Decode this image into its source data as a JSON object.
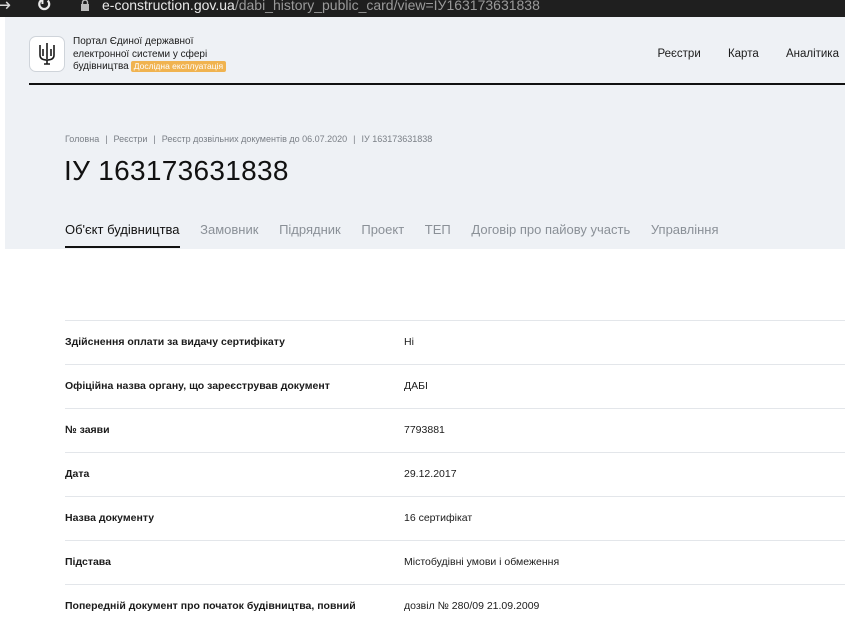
{
  "browser": {
    "domain": "e-construction.gov.ua",
    "path": "/dabi_history_public_card/view=ІУ163173631838"
  },
  "header": {
    "portal_line1": "Портал Єдиної державної",
    "portal_line2": "електронної системи у сфері",
    "portal_line3": "будівництва",
    "badge": "Дослідна експлуатація",
    "nav": [
      "Реєстри",
      "Карта",
      "Аналітика"
    ]
  },
  "breadcrumbs": [
    "Головна",
    "Реєстри",
    "Реєстр дозвільних документів до 06.07.2020",
    "ІУ 163173631838"
  ],
  "page_title": "ІУ 163173631838",
  "tabs": [
    "Об'єкт будівництва",
    "Замовник",
    "Підрядник",
    "Проект",
    "ТЕП",
    "Договір про пайову участь",
    "Управління"
  ],
  "rows": [
    {
      "label": "Здійснення оплати за видачу сертифікату",
      "value": "Ні"
    },
    {
      "label": "Офіційна назва органу, що зареєстрував документ",
      "value": "ДАБІ"
    },
    {
      "label": "№ заяви",
      "value": "7793881"
    },
    {
      "label": "Дата",
      "value": "29.12.2017"
    },
    {
      "label": "Назва документу",
      "value": "16 сертифікат"
    },
    {
      "label": "Підстава",
      "value": "Містобудівні умови і обмеження"
    },
    {
      "label": "Попередній документ про початок будівництва, повний",
      "value": "дозвіл № 280/09 21.09.2009"
    }
  ]
}
